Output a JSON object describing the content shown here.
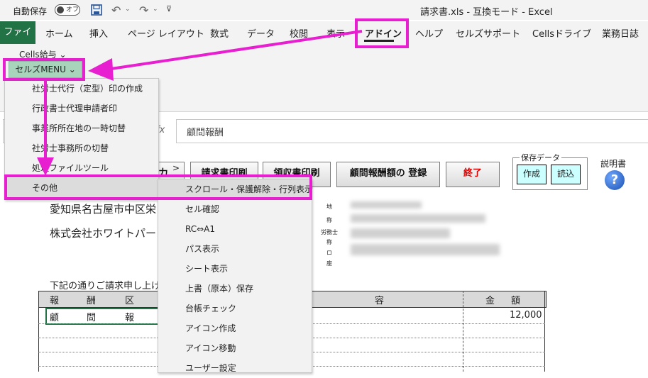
{
  "titlebar": {
    "autosave_label": "自動保存",
    "autosave_state": "オフ",
    "document_title": "請求書.xls - 互換モード - Excel"
  },
  "tabs": [
    "ファイル",
    "ホーム",
    "挿入",
    "ページ レイアウト",
    "数式",
    "データ",
    "校閲",
    "表示",
    "アドイン",
    "ヘルプ",
    "セルズサポート",
    "Cellsドライブ",
    "業務日誌"
  ],
  "ribbon": {
    "cells_kyuyo": "Cells給与 ⌄",
    "cellz_menu": "セルズMENU ⌄"
  },
  "formula_bar": {
    "fx": "fx",
    "content": "顧問報酬"
  },
  "sheet": {
    "buttons": {
      "partial": "力",
      "invoice_print": "請求書印刷",
      "receipt_print": "領収書印刷",
      "register": "顧問報酬額の 登録",
      "exit": "終了"
    },
    "save_data": {
      "label": "保存データ",
      "create": "作成",
      "read": "読込"
    },
    "manual_label": "説明書",
    "address": "愛知県名古屋市中区栄",
    "company": "株式会社ホワイトパートナ",
    "greeting": "下記の通りご請求申し上げま",
    "side_labels": [
      "地",
      "称",
      "労務士",
      "称",
      "ロ",
      "座"
    ],
    "table": {
      "headers": [
        "報",
        "酬",
        "区",
        "容",
        "金",
        "額"
      ],
      "row1": [
        "顧",
        "問",
        "報"
      ],
      "amount": "12,000"
    }
  },
  "menu": {
    "items": [
      {
        "label": "社労士代行（定型）印の作成",
        "submenu": false
      },
      {
        "label": "行政書士代理申請者印",
        "submenu": false
      },
      {
        "label": "事業所所在地の一時切替",
        "submenu": false
      },
      {
        "label": "社労士事務所の切替",
        "submenu": false
      },
      {
        "label": "処理ファイルツール",
        "submenu": true
      },
      {
        "label": "その他",
        "submenu": true
      }
    ],
    "chevron": ">"
  },
  "submenu": {
    "items": [
      "スクロール・保護解除・行列表示",
      "セル確認",
      "RC⇔A1",
      "パス表示",
      "シート表示",
      "上書（原本）保存",
      "台帳チェック",
      "アイコン作成",
      "アイコン移動",
      "ユーザー設定"
    ]
  },
  "colors": {
    "file_tab": "#217346",
    "highlight": "#e81fd0",
    "menu_button": "#a9d4bc",
    "exit_text": "#e00000"
  }
}
